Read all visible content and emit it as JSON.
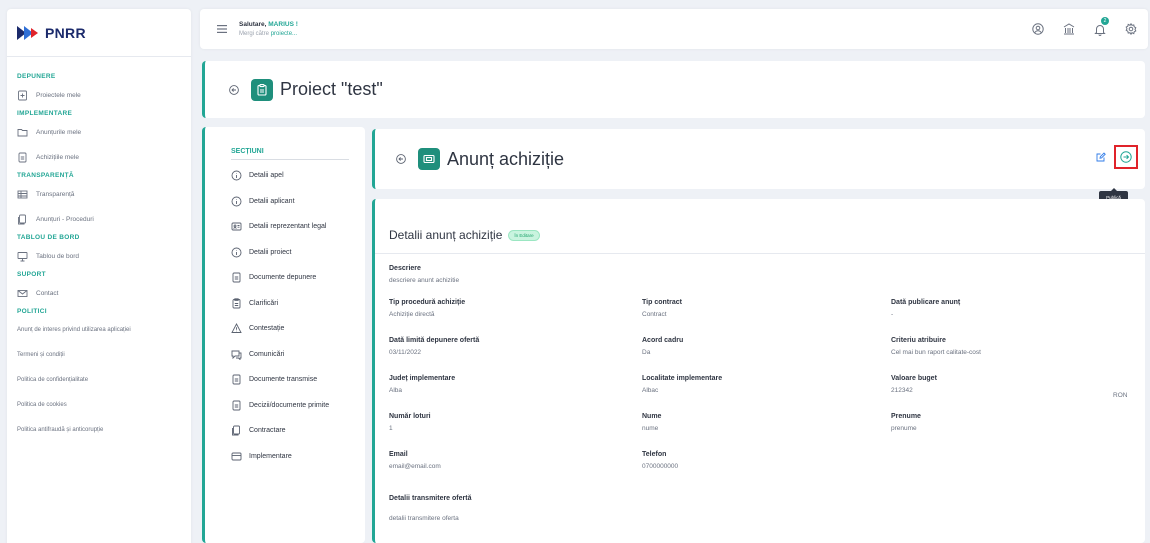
{
  "brand": {
    "name": "PNRR",
    "accent": "#22a695"
  },
  "sidebar": {
    "sections": [
      {
        "label": "DEPUNERE",
        "items": [
          {
            "label": "Proiectele mele",
            "icon": "document-add-icon"
          }
        ]
      },
      {
        "label": "IMPLEMENTARE",
        "items": [
          {
            "label": "Anunțurile mele",
            "icon": "folder-icon"
          },
          {
            "label": "Achizițiile mele",
            "icon": "document-icon"
          }
        ]
      },
      {
        "label": "TRANSPARENȚĂ",
        "items": [
          {
            "label": "Transparență",
            "icon": "table-icon"
          },
          {
            "label": "Anunțuri - Proceduri",
            "icon": "files-icon"
          }
        ]
      },
      {
        "label": "TABLOU DE BORD",
        "items": [
          {
            "label": "Tablou de bord",
            "icon": "monitor-icon"
          }
        ]
      },
      {
        "label": "SUPORT",
        "items": [
          {
            "label": "Contact",
            "icon": "mail-icon"
          }
        ]
      },
      {
        "label": "POLITICI",
        "items": []
      }
    ],
    "policy_links": [
      "Anunț de interes privind utilizarea aplicației",
      "Termeni și condiții",
      "Politica de confidențialitate",
      "Politica de cookies",
      "Politica antifraudă și anticorupție"
    ]
  },
  "topbar": {
    "greeting_prefix": "Salutare, ",
    "user": "MARIUS !",
    "nav_prefix": "Mergi către ",
    "nav_link": "proiecte..."
  },
  "project": {
    "title": "Proiect \"test\""
  },
  "sections": {
    "title": "SECȚIUNI",
    "items": [
      {
        "label": "Detalii apel",
        "icon": "info-icon"
      },
      {
        "label": "Detalii aplicant",
        "icon": "info-icon"
      },
      {
        "label": "Detalii reprezentant legal",
        "icon": "id-card-icon"
      },
      {
        "label": "Detalii proiect",
        "icon": "info-icon"
      },
      {
        "label": "Documente depunere",
        "icon": "document-icon"
      },
      {
        "label": "Clarificări",
        "icon": "clipboard-icon"
      },
      {
        "label": "Contestație",
        "icon": "warning-icon"
      },
      {
        "label": "Comunicări",
        "icon": "chat-icon"
      },
      {
        "label": "Documente transmise",
        "icon": "document-icon"
      },
      {
        "label": "Decizii/documente primite",
        "icon": "document-icon"
      },
      {
        "label": "Contractare",
        "icon": "files-icon"
      },
      {
        "label": "Implementare",
        "icon": "card-icon"
      }
    ]
  },
  "announcement": {
    "title": "Anunț achiziție",
    "publish_tooltip": "Publică"
  },
  "details": {
    "title": "Detalii anunț achiziție",
    "status": "În Editare",
    "description": {
      "label": "Descriere",
      "value": "descriere anunt achizitie"
    },
    "rows": [
      [
        {
          "label": "Tip procedură achiziție",
          "value": "Achiziție directă"
        },
        {
          "label": "Tip contract",
          "value": "Contract"
        },
        {
          "label": "Dată publicare anunț",
          "value": "-"
        }
      ],
      [
        {
          "label": "Dată limită depunere ofertă",
          "value": "03/11/2022"
        },
        {
          "label": "Acord cadru",
          "value": "Da"
        },
        {
          "label": "Criteriu atribuire",
          "value": "Cel mai bun raport calitate-cost"
        }
      ],
      [
        {
          "label": "Județ implementare",
          "value": "Alba"
        },
        {
          "label": "Localitate implementare",
          "value": "Albac"
        },
        {
          "label": "Valoare buget",
          "value": "212342"
        }
      ],
      [
        {
          "label": "Număr loturi",
          "value": "1"
        },
        {
          "label": "Nume",
          "value": "nume"
        },
        {
          "label": "Prenume",
          "value": "prenume"
        }
      ],
      [
        {
          "label": "Email",
          "value": "email@email.com"
        },
        {
          "label": "Telefon",
          "value": "0700000000"
        }
      ]
    ],
    "currency": "RON",
    "transmission": {
      "label": "Detalii transmitere ofertă",
      "value": "detalii transmitere oferta"
    }
  }
}
